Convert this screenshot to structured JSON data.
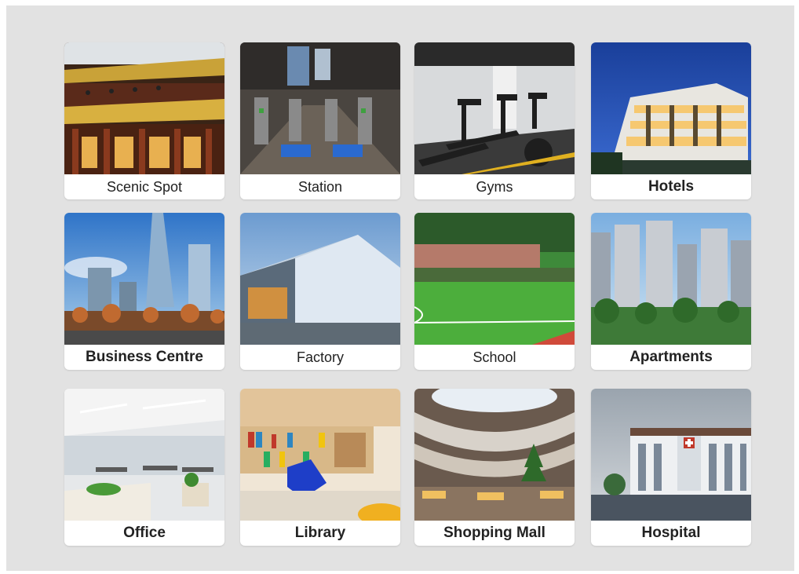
{
  "cards": [
    {
      "label": "Scenic Spot",
      "icon": "pagoda-photo"
    },
    {
      "label": "Station",
      "icon": "station-gates-photo"
    },
    {
      "label": "Gyms",
      "icon": "treadmill-photo"
    },
    {
      "label": "Hotels",
      "icon": "hotel-night-photo"
    },
    {
      "label": "Business Centre",
      "icon": "skyscraper-photo"
    },
    {
      "label": "Factory",
      "icon": "factory-building-photo"
    },
    {
      "label": "School",
      "icon": "sports-field-photo"
    },
    {
      "label": "Apartments",
      "icon": "apartment-towers-photo"
    },
    {
      "label": "Office",
      "icon": "office-desks-photo"
    },
    {
      "label": "Library",
      "icon": "bookshelves-photo"
    },
    {
      "label": "Shopping Mall",
      "icon": "mall-atrium-photo"
    },
    {
      "label": "Hospital",
      "icon": "hospital-building-photo"
    }
  ],
  "colors": {
    "panel": "#e2e2e2",
    "card": "#ffffff",
    "label_text": "#222222",
    "watermark_blue": "#3aa0e0",
    "watermark_red": "#e05050"
  }
}
